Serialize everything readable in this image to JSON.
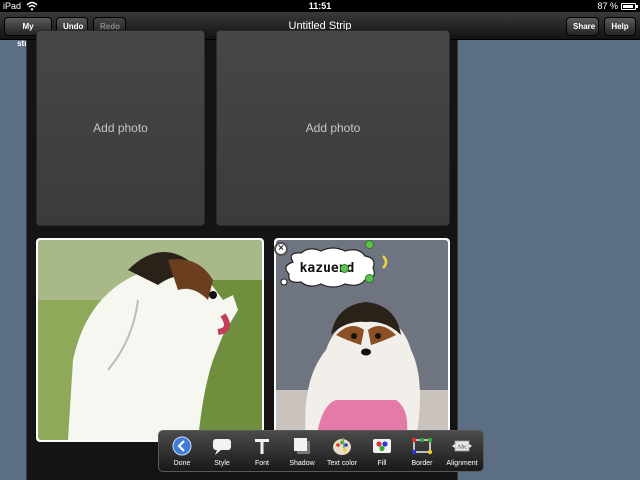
{
  "status_bar": {
    "device": "iPad",
    "time": "11:51",
    "battery": "87 %"
  },
  "nav_bar": {
    "title": "Untitled Strip",
    "my_strips": "My strips",
    "undo": "Undo",
    "redo": "Redo",
    "share": "Share",
    "help": "Help"
  },
  "panels": {
    "top_left": "Add photo",
    "top_right": "Add photo"
  },
  "bubble": {
    "text": "kazuend"
  },
  "toolbar": {
    "items": [
      {
        "label": "Done",
        "icon": "back-arrow-icon"
      },
      {
        "label": "Style",
        "icon": "speech-bubble-icon"
      },
      {
        "label": "Font",
        "icon": "font-t-icon"
      },
      {
        "label": "Shadow",
        "icon": "shadow-icon"
      },
      {
        "label": "Text color",
        "icon": "palette-icon"
      },
      {
        "label": "Fill",
        "icon": "fill-icon"
      },
      {
        "label": "Border",
        "icon": "border-icon"
      },
      {
        "label": "Alignment",
        "icon": "alignment-icon"
      }
    ]
  },
  "colors": {
    "background": "#5b6e84",
    "accent_blue": "#3f7bd9",
    "handle_green": "#5ec14f"
  }
}
